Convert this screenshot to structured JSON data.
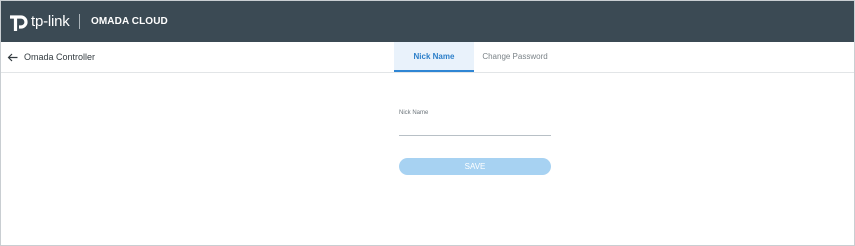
{
  "header": {
    "brand": "tp-link",
    "brand_icon": "tp-link-logo-icon",
    "product": "OMADA CLOUD",
    "background_color": "#3b4a54"
  },
  "subheader": {
    "back_icon": "arrow-left-icon",
    "back_label": "Omada Controller",
    "tabs": [
      {
        "label": "Nick Name",
        "active": true
      },
      {
        "label": "Change Password",
        "active": false
      }
    ],
    "accent_color": "#2c7fc9"
  },
  "form": {
    "nick_name_label": "Nick Name",
    "nick_name_value": "",
    "nick_name_placeholder": "",
    "save_label": "SAVE",
    "save_color": "#a7d2f2"
  }
}
